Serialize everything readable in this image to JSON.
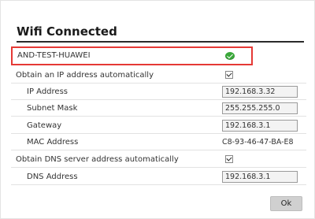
{
  "dialog": {
    "title": "Wifi Connected",
    "ssid": "AND-TEST-HUAWEI",
    "status_icon": "check-circle-icon",
    "status_color": "#3aa83a",
    "highlight_color": "#e53935",
    "ip_auto_label": "Obtain an IP address automatically",
    "ip_auto_checked": true,
    "ip_address_label": "IP Address",
    "ip_address_value": "192.168.3.32",
    "subnet_label": "Subnet Mask",
    "subnet_value": "255.255.255.0",
    "gateway_label": "Gateway",
    "gateway_value": "192.168.3.1",
    "mac_label": "MAC Address",
    "mac_value": "C8-93-46-47-BA-E8",
    "dns_auto_label": "Obtain DNS server address automatically",
    "dns_auto_checked": true,
    "dns_label": "DNS Address",
    "dns_value": "192.168.3.1",
    "ok_label": "Ok"
  }
}
